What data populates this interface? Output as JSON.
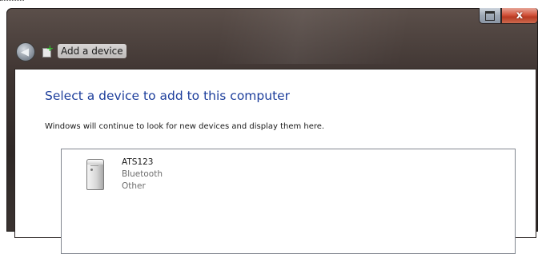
{
  "window": {
    "title": "Add a device",
    "close_glyph": "x"
  },
  "content": {
    "heading": "Select a device to add to this computer",
    "description": "Windows will continue to look for new devices and display them here."
  },
  "devices": [
    {
      "name": "ATS123",
      "type": "Bluetooth",
      "category": "Other",
      "icon": "speaker-device-icon"
    }
  ],
  "colors": {
    "heading": "#1e3f9c",
    "close_button": "#c94a33",
    "frame": "#3a3230"
  },
  "icons": {
    "back": "back-arrow-icon",
    "title": "add-device-icon",
    "restore": "restore-icon",
    "close": "close-icon"
  }
}
